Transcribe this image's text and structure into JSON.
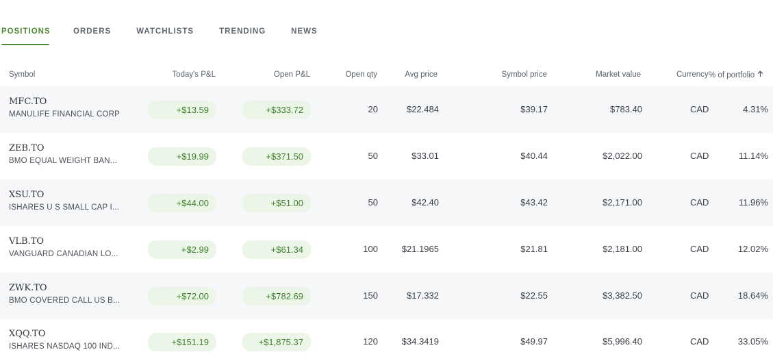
{
  "tabs": [
    {
      "label": "POSITIONS",
      "active": true
    },
    {
      "label": "ORDERS",
      "active": false
    },
    {
      "label": "WATCHLISTS",
      "active": false
    },
    {
      "label": "TRENDING",
      "active": false
    },
    {
      "label": "NEWS",
      "active": false
    }
  ],
  "columns": {
    "symbol": "Symbol",
    "todays_pnl": "Today's P&L",
    "open_pnl": "Open P&L",
    "open_qty": "Open qty",
    "avg_price": "Avg price",
    "symbol_price": "Symbol price",
    "market_value": "Market value",
    "currency": "Currency",
    "pct_portfolio": "% of portfolio",
    "sort_icon": "arrow-up-icon"
  },
  "colors": {
    "accent": "#4f8a35",
    "gain_text": "#3f7f2b",
    "gain_bg": "#ecf6e8",
    "row_shade": "#f6f7f9"
  },
  "positions": [
    {
      "symbol": "MFC.TO",
      "name": "MANULIFE FINANCIAL CORP",
      "todays_pnl": "+$13.59",
      "open_pnl": "+$333.72",
      "open_qty": "20",
      "avg_price": "$22.484",
      "symbol_price": "$39.17",
      "market_value": "$783.40",
      "currency": "CAD",
      "pct_portfolio": "4.31%"
    },
    {
      "symbol": "ZEB.TO",
      "name": "BMO EQUAL WEIGHT BAN...",
      "todays_pnl": "+$19.99",
      "open_pnl": "+$371.50",
      "open_qty": "50",
      "avg_price": "$33.01",
      "symbol_price": "$40.44",
      "market_value": "$2,022.00",
      "currency": "CAD",
      "pct_portfolio": "11.14%"
    },
    {
      "symbol": "XSU.TO",
      "name": "ISHARES U S SMALL CAP I...",
      "todays_pnl": "+$44.00",
      "open_pnl": "+$51.00",
      "open_qty": "50",
      "avg_price": "$42.40",
      "symbol_price": "$43.42",
      "market_value": "$2,171.00",
      "currency": "CAD",
      "pct_portfolio": "11.96%"
    },
    {
      "symbol": "VLB.TO",
      "name": "VANGUARD CANADIAN LO...",
      "todays_pnl": "+$2.99",
      "open_pnl": "+$61.34",
      "open_qty": "100",
      "avg_price": "$21.1965",
      "symbol_price": "$21.81",
      "market_value": "$2,181.00",
      "currency": "CAD",
      "pct_portfolio": "12.02%"
    },
    {
      "symbol": "ZWK.TO",
      "name": "BMO COVERED CALL US B...",
      "todays_pnl": "+$72.00",
      "open_pnl": "+$782.69",
      "open_qty": "150",
      "avg_price": "$17.332",
      "symbol_price": "$22.55",
      "market_value": "$3,382.50",
      "currency": "CAD",
      "pct_portfolio": "18.64%"
    },
    {
      "symbol": "XQQ.TO",
      "name": "ISHARES NASDAQ 100 IND...",
      "todays_pnl": "+$151.19",
      "open_pnl": "+$1,875.37",
      "open_qty": "120",
      "avg_price": "$34.3419",
      "symbol_price": "$49.97",
      "market_value": "$5,996.40",
      "currency": "CAD",
      "pct_portfolio": "33.05%"
    }
  ]
}
